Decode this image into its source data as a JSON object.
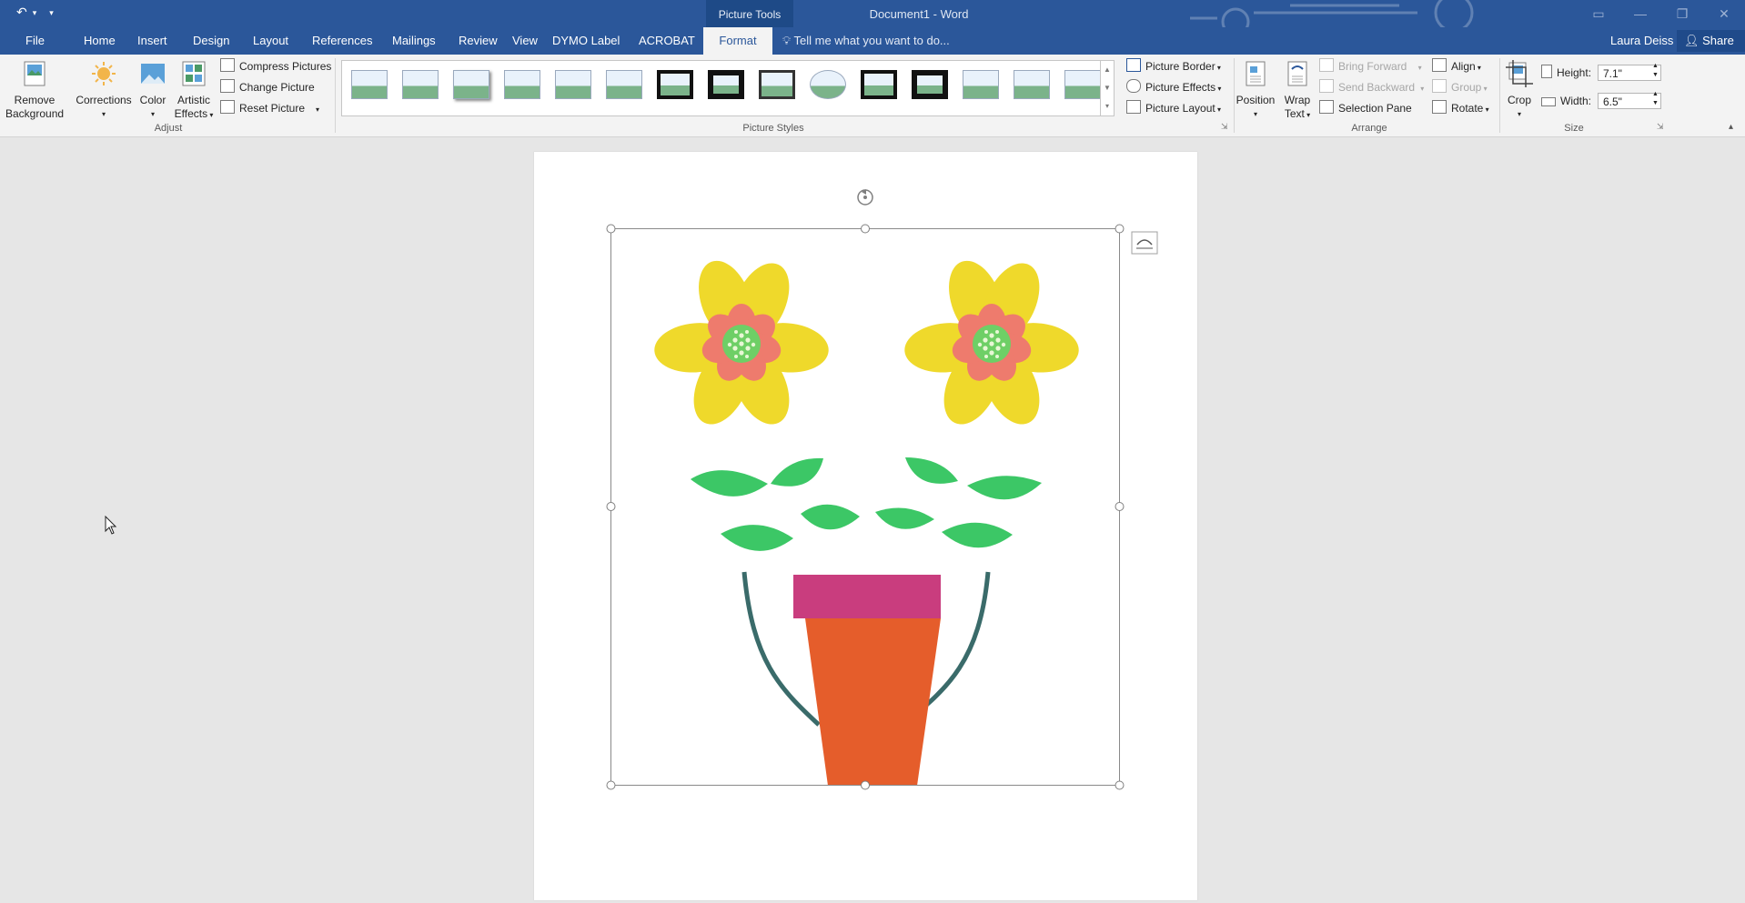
{
  "titlebar": {
    "picture_tools": "Picture Tools",
    "document_title": "Document1 - Word"
  },
  "tabs": [
    "File",
    "Home",
    "Insert",
    "Design",
    "Layout",
    "References",
    "Mailings",
    "Review",
    "View",
    "DYMO Label",
    "ACROBAT",
    "Format"
  ],
  "active_tab": "Format",
  "tell_me": "Tell me what you want to do...",
  "user": {
    "name": "Laura Deiss",
    "share": "Share"
  },
  "ribbon": {
    "adjust": {
      "remove_background": [
        "Remove",
        "Background"
      ],
      "corrections": "Corrections",
      "color": "Color",
      "artistic_effects": [
        "Artistic",
        "Effects"
      ],
      "compress": "Compress Pictures",
      "change": "Change Picture",
      "reset": "Reset Picture",
      "label": "Adjust"
    },
    "picture_styles": {
      "label": "Picture Styles",
      "border": "Picture Border",
      "effects": "Picture Effects",
      "layout": "Picture Layout"
    },
    "arrange": {
      "position": "Position",
      "wrap_text": [
        "Wrap",
        "Text"
      ],
      "bring_forward": "Bring Forward",
      "send_backward": "Send Backward",
      "selection_pane": "Selection Pane",
      "align": "Align",
      "group": "Group",
      "rotate": "Rotate",
      "label": "Arrange"
    },
    "size": {
      "crop": "Crop",
      "height_label": "Height:",
      "height_value": "7.1\"",
      "width_label": "Width:",
      "width_value": "6.5\"",
      "label": "Size"
    }
  },
  "icons": {
    "undo": "undo-icon",
    "lightbulb": "lightbulb-icon",
    "person": "person-icon",
    "rotate_handle": "rotate-handle-icon",
    "layout_options": "layout-options-icon",
    "cursor": "mouse-pointer-icon"
  },
  "colors": {
    "ribbon_blue": "#2b579a",
    "petal_yellow": "#efd92b",
    "petal_salmon": "#ee7b6d",
    "center_green": "#6ecf66",
    "stem": "#3a6b6a",
    "leaf": "#3cc766",
    "pot_rim": "#c93d7e",
    "pot_body": "#e55d2b"
  }
}
